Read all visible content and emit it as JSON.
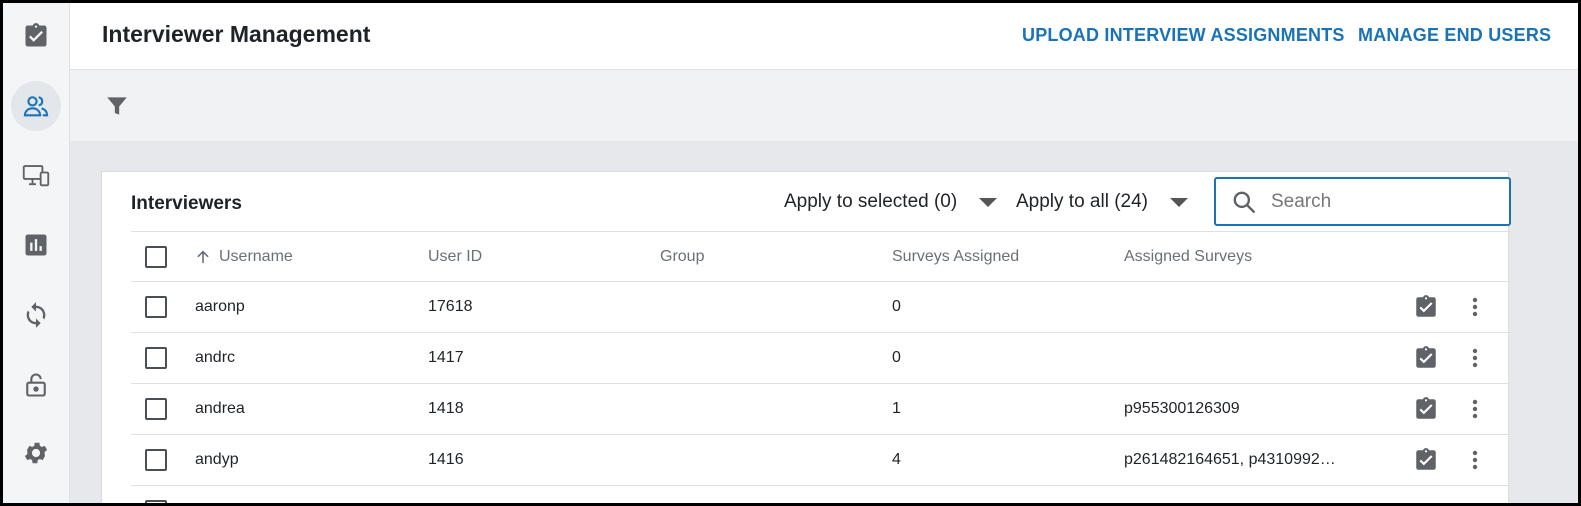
{
  "header": {
    "title": "Interviewer Management",
    "links": [
      "UPLOAD INTERVIEW ASSIGNMENTS",
      "MANAGE END USERS"
    ]
  },
  "sidebar": {
    "items": [
      {
        "icon": "clipboard-check-icon",
        "active": false
      },
      {
        "icon": "users-icon",
        "active": true
      },
      {
        "icon": "devices-icon",
        "active": false
      },
      {
        "icon": "bar-chart-icon",
        "active": false
      },
      {
        "icon": "sync-icon",
        "active": false
      },
      {
        "icon": "unlock-icon",
        "active": false
      },
      {
        "icon": "gear-icon",
        "active": false
      }
    ]
  },
  "filter": {
    "icon": "filter-icon"
  },
  "card": {
    "title": "Interviewers",
    "apply_selected": "Apply to selected (0)",
    "apply_all": "Apply to all (24)",
    "search_placeholder": "Search"
  },
  "table": {
    "columns": [
      "Username",
      "User ID",
      "Group",
      "Surveys Assigned",
      "Assigned Surveys"
    ],
    "rows": [
      {
        "username": "aaronp",
        "user_id": "17618",
        "group": "",
        "surveys_assigned": "0",
        "assigned_surveys": ""
      },
      {
        "username": "andrc",
        "user_id": "1417",
        "group": "",
        "surveys_assigned": "0",
        "assigned_surveys": ""
      },
      {
        "username": "andrea",
        "user_id": "1418",
        "group": "",
        "surveys_assigned": "1",
        "assigned_surveys": "p955300126309"
      },
      {
        "username": "andyp",
        "user_id": "1416",
        "group": "",
        "surveys_assigned": "4",
        "assigned_surveys": "p261482164651, p4310992…"
      }
    ]
  },
  "colors": {
    "accent": "#1a73b5",
    "icon_gray": "#5f6368"
  }
}
